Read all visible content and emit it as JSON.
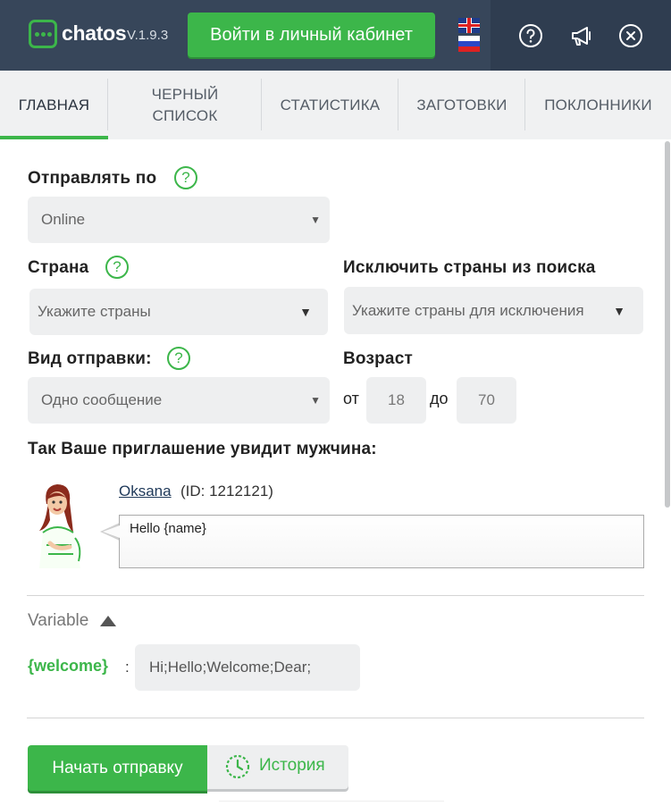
{
  "header": {
    "brand": "chatos",
    "version": "V.1.9.3",
    "login_button": "Войти в личный кабинет",
    "languages": [
      "english-flag-icon",
      "russian-flag-icon"
    ],
    "icons": [
      "help-circle-icon",
      "megaphone-icon",
      "close-circle-icon"
    ]
  },
  "tabs": [
    {
      "label": "ГЛАВНАЯ",
      "active": true
    },
    {
      "label": "ЧЕРНЫЙ\nСПИСОК",
      "active": false
    },
    {
      "label": "СТАТИСТИКА",
      "active": false
    },
    {
      "label": "ЗАГОТОВКИ",
      "active": false
    },
    {
      "label": "ПОКЛОННИКИ",
      "active": false
    }
  ],
  "form": {
    "send_by": {
      "label": "Отправлять по",
      "value": "Online"
    },
    "country": {
      "label": "Страна",
      "placeholder": "Укажите страны"
    },
    "exclude_countries": {
      "label": "Исключить страны из поиска",
      "placeholder": "Укажите страны для исключения"
    },
    "send_type": {
      "label": "Вид отправки:",
      "value": "Одно сообщение"
    },
    "age": {
      "label": "Возраст",
      "from_label": "от",
      "from_value": "18",
      "to_label": "до",
      "to_value": "70"
    }
  },
  "preview": {
    "title": "Так Ваше приглашение увидит мужчина:",
    "profile_name": "Oksana",
    "profile_id": "(ID: 1212121)",
    "message": "Hello {name}"
  },
  "variables": {
    "title": "Variable",
    "items": [
      {
        "key": "{welcome}",
        "separator": ":",
        "value": "Hi;Hello;Welcome;Dear;"
      }
    ]
  },
  "actions": {
    "start_button": "Начать отправку",
    "history_button": "История"
  },
  "colors": {
    "accent": "#3cb64a",
    "header_bg": "#37465a",
    "tabs_bg": "#f0f1f2",
    "field_bg": "#eeeff0"
  }
}
